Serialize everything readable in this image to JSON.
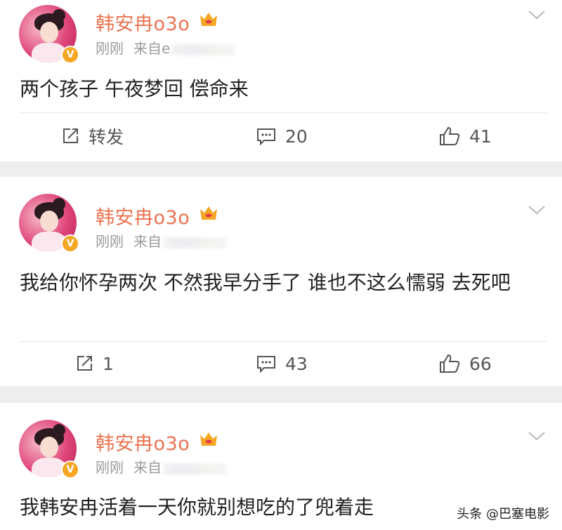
{
  "posts": [
    {
      "username": "韩安冉o3o",
      "time": "刚刚",
      "source": "来自e",
      "content": "两个孩子 午夜梦回 偿命来",
      "repost": "转发",
      "comments": "20",
      "likes": "41"
    },
    {
      "username": "韩安冉o3o",
      "time": "刚刚",
      "source": "来自",
      "content": "我给你怀孕两次 不然我早分手了 谁也不这么懦弱 去死吧",
      "repost": "1",
      "comments": "43",
      "likes": "66"
    },
    {
      "username": "韩安冉o3o",
      "time": "刚刚",
      "source": "来自",
      "content": "我韩安冉活着一天你就别想吃的了兜着走"
    }
  ],
  "watermark": "头条 @巴塞电影",
  "colors": {
    "username": "#eb7350",
    "verified_badge": "#f5a623",
    "text": "#222222",
    "meta": "#9b9b9b",
    "separator": "#eeeeee"
  },
  "icons": {
    "repost": "repost-icon",
    "comment": "comment-icon",
    "like": "thumbs-up-icon",
    "menu": "chevron-down-icon",
    "vip": "vip-crown-icon",
    "verified": "verified-v-icon"
  }
}
